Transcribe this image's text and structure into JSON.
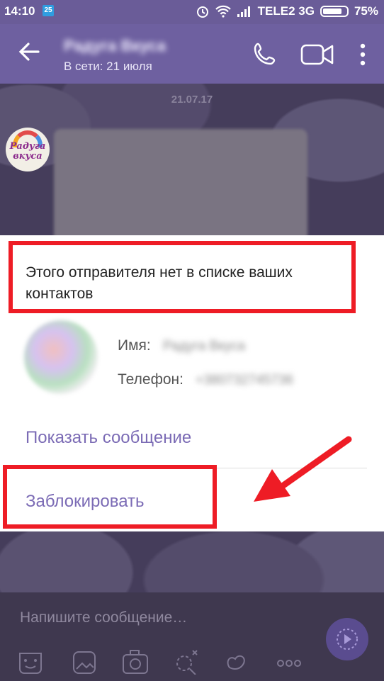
{
  "status_bar": {
    "time": "14:10",
    "calendar_badge": "25",
    "carrier": "TELE2 3G",
    "battery": "75%"
  },
  "toolbar": {
    "contact_name": "Радуга Вкуса",
    "last_seen": "В сети: 21 июля"
  },
  "chat": {
    "date": "21.07.17",
    "avatar_text": "Радуга вкуса"
  },
  "dialog": {
    "notice": "Этого отправителя нет в списке ваших контактов",
    "name_label": "Имя:",
    "name_value": "Радуга Вкуса",
    "phone_label": "Телефон:",
    "phone_value": "+380732745736",
    "show_message": "Показать сообщение",
    "block": "Заблокировать"
  },
  "composer": {
    "placeholder": "Напишите сообщение…"
  },
  "colors": {
    "toolbar": "#6e60a0",
    "accent": "#7b6bb5",
    "annotation_red": "#ee1c25"
  },
  "icons": [
    "back-arrow-icon",
    "phone-icon",
    "video-icon",
    "more-vert-icon",
    "sticker-icon",
    "gallery-icon",
    "camera-icon",
    "doodle-icon",
    "gif-icon",
    "more-horiz-icon",
    "send-video-icon"
  ]
}
